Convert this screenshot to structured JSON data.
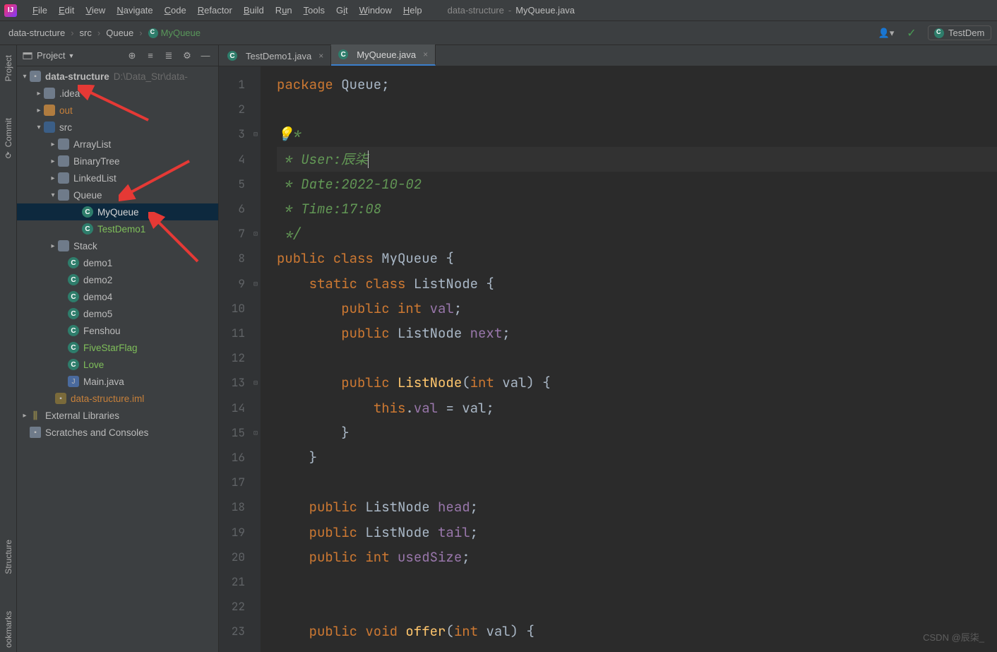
{
  "window": {
    "project": "data-structure",
    "file": "MyQueue.java",
    "sep": " - "
  },
  "menu": [
    "File",
    "Edit",
    "View",
    "Navigate",
    "Code",
    "Refactor",
    "Build",
    "Run",
    "Tools",
    "Git",
    "Window",
    "Help"
  ],
  "breadcrumbs": {
    "root": "data-structure",
    "p1": "src",
    "p2": "Queue",
    "current": "MyQueue"
  },
  "run_config": "TestDem",
  "project_panel": {
    "title": "Project",
    "root_name": "data-structure",
    "root_path": "D:\\Data_Str\\data-",
    "idea": ".idea",
    "out": "out",
    "src": "src",
    "src_children": [
      "ArrayList",
      "BinaryTree",
      "LinkedList",
      "Queue",
      "Stack"
    ],
    "queue_children": [
      {
        "name": "MyQueue",
        "sel": true
      },
      {
        "name": "TestDemo1",
        "green": true
      }
    ],
    "classes": [
      {
        "name": "demo1"
      },
      {
        "name": "demo2"
      },
      {
        "name": "demo4"
      },
      {
        "name": "demo5"
      },
      {
        "name": "Fenshou"
      },
      {
        "name": "FiveStarFlag",
        "green": true
      },
      {
        "name": "Love",
        "green": true
      }
    ],
    "mainjava": "Main.java",
    "iml": "data-structure.iml",
    "ext": "External Libraries",
    "scratch": "Scratches and Consoles"
  },
  "tabs": [
    {
      "name": "TestDemo1.java",
      "active": false
    },
    {
      "name": "MyQueue.java",
      "active": true
    }
  ],
  "code": {
    "l1a": "package ",
    "l1b": "Queue",
    "l1c": ";",
    "l3": "/**",
    "l4": " * User:辰柒",
    "l5": " * Date:2022-10-02",
    "l6": " * Time:17:08",
    "l7": " */",
    "l8a": "public class ",
    "l8b": "MyQueue ",
    "l8c": "{",
    "l9a": "    static class ",
    "l9b": "ListNode ",
    "l9c": "{",
    "l10a": "        public int ",
    "l10b": "val",
    "l10c": ";",
    "l11a": "        public ",
    "l11b": "ListNode ",
    "l11c": "next",
    "l11d": ";",
    "l13a": "        public ",
    "l13b": "ListNode",
    "l13c": "(",
    "l13d": "int ",
    "l13e": "val) {",
    "l14a": "            ",
    "l14b": "this",
    "l14c": ".",
    "l14d": "val ",
    "l14e": "= val;",
    "l15": "        }",
    "l16": "    }",
    "l18a": "    public ",
    "l18b": "ListNode ",
    "l18c": "head",
    "l18d": ";",
    "l19a": "    public ",
    "l19b": "ListNode ",
    "l19c": "tail",
    "l19d": ";",
    "l20a": "    public int ",
    "l20b": "usedSize",
    "l20c": ";",
    "l23a": "    public void ",
    "l23b": "offer",
    "l23c": "(",
    "l23d": "int ",
    "l23e": "val) {"
  },
  "side_labels": {
    "project": "Project",
    "commit": "Commit",
    "structure": "Structure",
    "bookmarks": "ookmarks"
  },
  "watermark": "CSDN @辰柒_"
}
